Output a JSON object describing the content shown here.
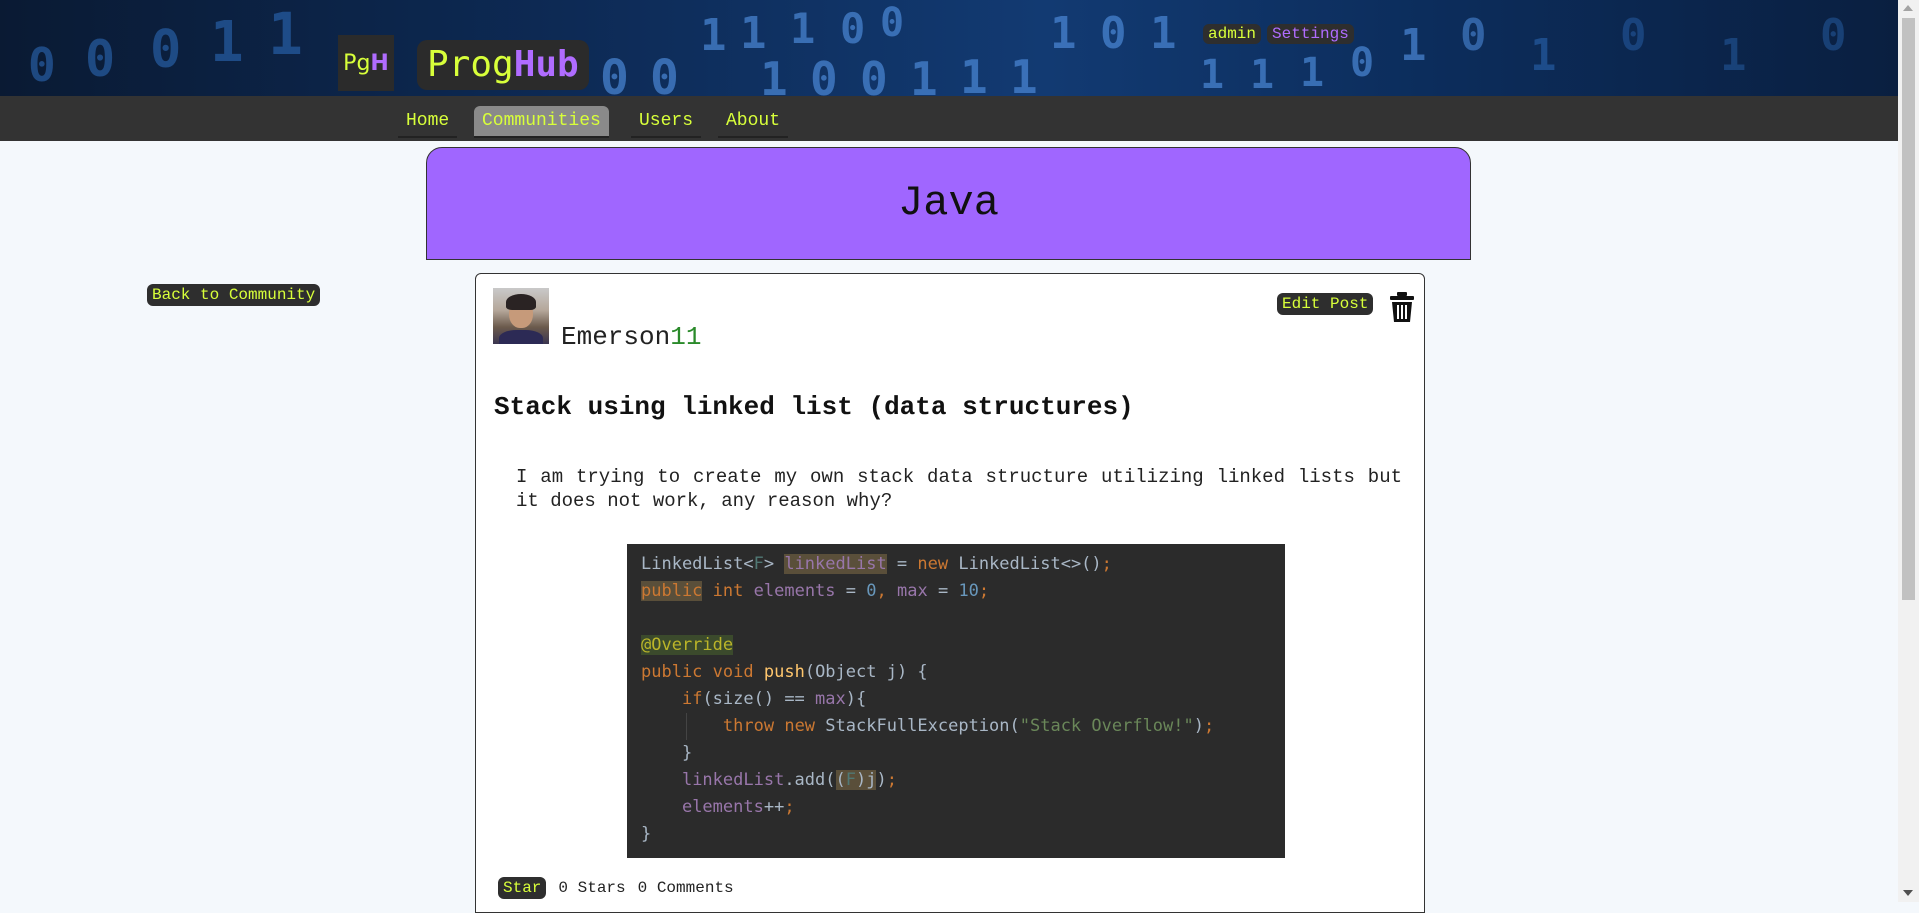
{
  "header": {
    "logo_mark_a": "Pg",
    "logo_mark_b": "H",
    "brand_a": "Prog",
    "brand_b": "Hub",
    "user_label": "admin",
    "settings_label": "Settings"
  },
  "nav": {
    "items": [
      {
        "label": "Home"
      },
      {
        "label": "Communities"
      },
      {
        "label": "Users"
      },
      {
        "label": "About"
      }
    ],
    "active": "Communities"
  },
  "community": {
    "title": "Java",
    "back_label": "Back to Community"
  },
  "post": {
    "author_name": "Emerson",
    "author_num": "11",
    "edit_label": "Edit Post",
    "title": "Stack using linked list (data structures)",
    "body": "I am trying to create my own stack data structure utilizing linked lists but it does not work, any reason why?",
    "star_label": "Star",
    "stars_text": "0 Stars",
    "comments_text": "0 Comments"
  },
  "colors": {
    "accent_lime": "#d8ff3a",
    "accent_purple": "#b06cff",
    "banner_purple": "#a066ff",
    "dark": "#2e2e2e"
  },
  "icons": [
    "trash-icon",
    "avatar"
  ]
}
